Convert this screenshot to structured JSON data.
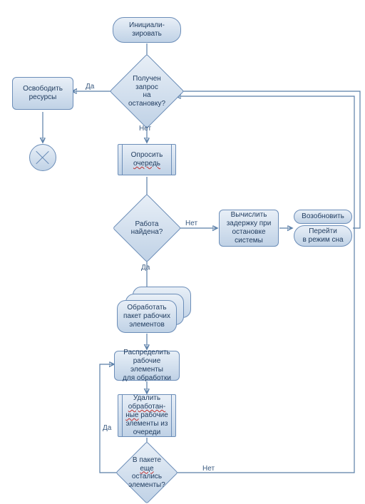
{
  "nodes": {
    "init": "Инициали-\nзировать",
    "stop_request": "Получен\nзапрос\nна\nостановку?",
    "release": "Освободить\nресурсы",
    "poll_queue_a": "Опросить",
    "poll_queue_b": "очередь",
    "work_found": "Работа\nнайдена?",
    "calc_delay": "Вычислить\nзадержку при\nостановке\nсистемы",
    "resume": "Возобновить",
    "sleep": "Перейти\nв режим сна",
    "batch": "Обработать\nпакет рабочих\nэлементов",
    "distribute": "Распределить\nрабочие элементы\nдля обработки",
    "delete_a": "Удалить",
    "delete_b": "обработан-",
    "delete_c": "ные",
    "delete_d": " рабочие",
    "delete_e": "элементы из",
    "delete_f": "очереди",
    "remaining_a": "В пакете",
    "remaining_b": "еще",
    "remaining_c": " остались",
    "remaining_d": "элементы?"
  },
  "edges": {
    "yes": "Да",
    "no": "Нет"
  }
}
